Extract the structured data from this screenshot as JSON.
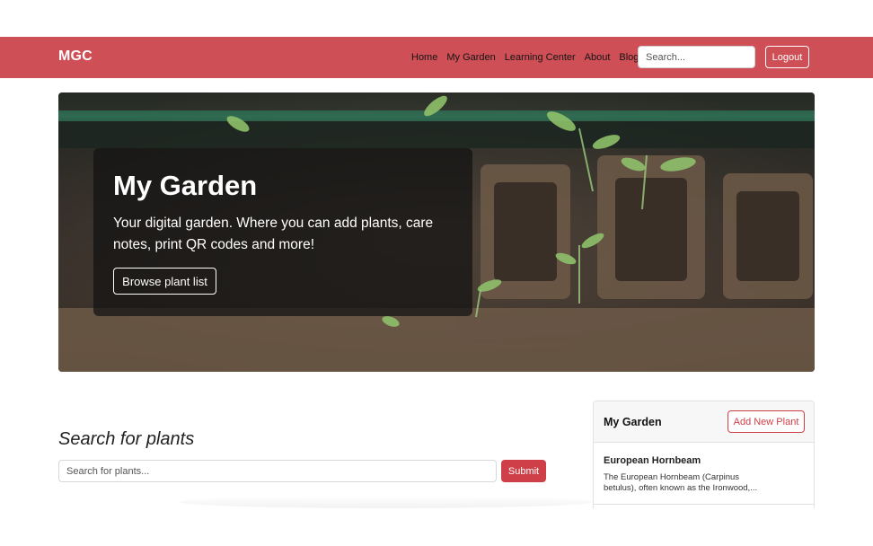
{
  "navbar": {
    "brand": "MGC",
    "links": [
      "Home",
      "My Garden",
      "Learning Center",
      "About",
      "Blog"
    ],
    "search_placeholder": "Search...",
    "logout_label": "Logout",
    "color": "#cf4f56"
  },
  "hero": {
    "title": "My Garden",
    "text": "Your digital garden. Where you can add plants, care notes, print QR codes and more!",
    "button_label": "Browse plant list"
  },
  "search": {
    "heading": "Search for plants",
    "placeholder": "Search for plants...",
    "submit_label": "Submit",
    "submit_color": "#cf3f47"
  },
  "garden_panel": {
    "title": "My Garden",
    "add_button_label": "Add New Plant",
    "plants": [
      {
        "name": "European Hornbeam",
        "description": "The European Hornbeam (Carpinus betulus), often known as the Ironwood,..."
      }
    ]
  }
}
